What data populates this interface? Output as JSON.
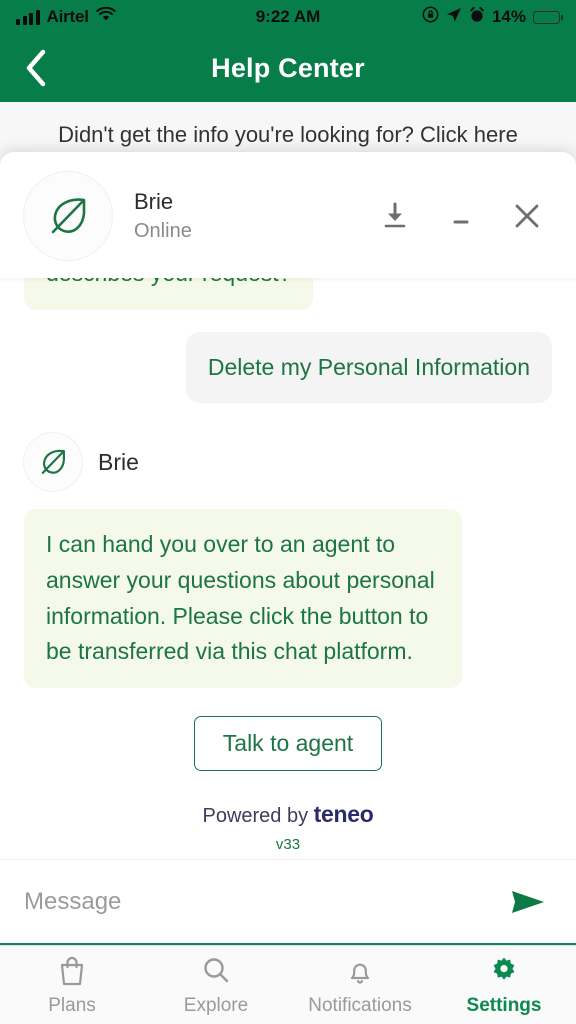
{
  "status_bar": {
    "carrier": "Airtel",
    "time": "9:22 AM",
    "battery_percent": "14%",
    "battery_level": 14,
    "icons": [
      "signal-icon",
      "wifi-icon",
      "rotation-lock-icon",
      "location-arrow-icon",
      "alarm-clock-icon",
      "battery-icon"
    ]
  },
  "nav": {
    "title": "Help Center",
    "back_icon": "chevron-left-icon"
  },
  "page": {
    "banner_text": "Didn't get the info you're looking for? Click here"
  },
  "widget": {
    "avatar_icon": "leaf-icon",
    "bot_name": "Brie",
    "status": "Online",
    "actions": [
      {
        "name": "download-icon",
        "label": "Download transcript"
      },
      {
        "name": "minimize-icon",
        "label": "Minimize"
      },
      {
        "name": "close-icon",
        "label": "Close"
      }
    ],
    "messages": [
      {
        "sender": "bot",
        "text": "describes your request?",
        "clipped": true
      },
      {
        "sender": "user",
        "text": "Delete my Personal Information"
      },
      {
        "sender": "bot",
        "name": "Brie",
        "text": "I can hand you over to an agent to answer your questions about personal information. Please click the button to be transferred via this chat platform."
      }
    ],
    "action_button": "Talk to agent",
    "powered_by_prefix": "Powered by",
    "powered_by_brand": "teneo",
    "version": "v33",
    "composer": {
      "placeholder": "Message",
      "value": "",
      "send_icon": "send-arrow-icon"
    }
  },
  "tabbar": {
    "items": [
      {
        "label": "Plans",
        "icon": "shopping-bag-icon",
        "active": false
      },
      {
        "label": "Explore",
        "icon": "search-icon",
        "active": false
      },
      {
        "label": "Notifications",
        "icon": "bell-icon",
        "active": false
      },
      {
        "label": "Settings",
        "icon": "gear-icon",
        "active": true
      }
    ]
  },
  "colors": {
    "brand_green": "#077E49",
    "accent_green": "#1d7544",
    "bot_bubble": "#F4F9E9",
    "user_bubble": "#F4F4F4",
    "teneo_navy": "#2B2A6B",
    "battery_red": "#e8452c",
    "inactive_gray": "#9a9a9a"
  }
}
